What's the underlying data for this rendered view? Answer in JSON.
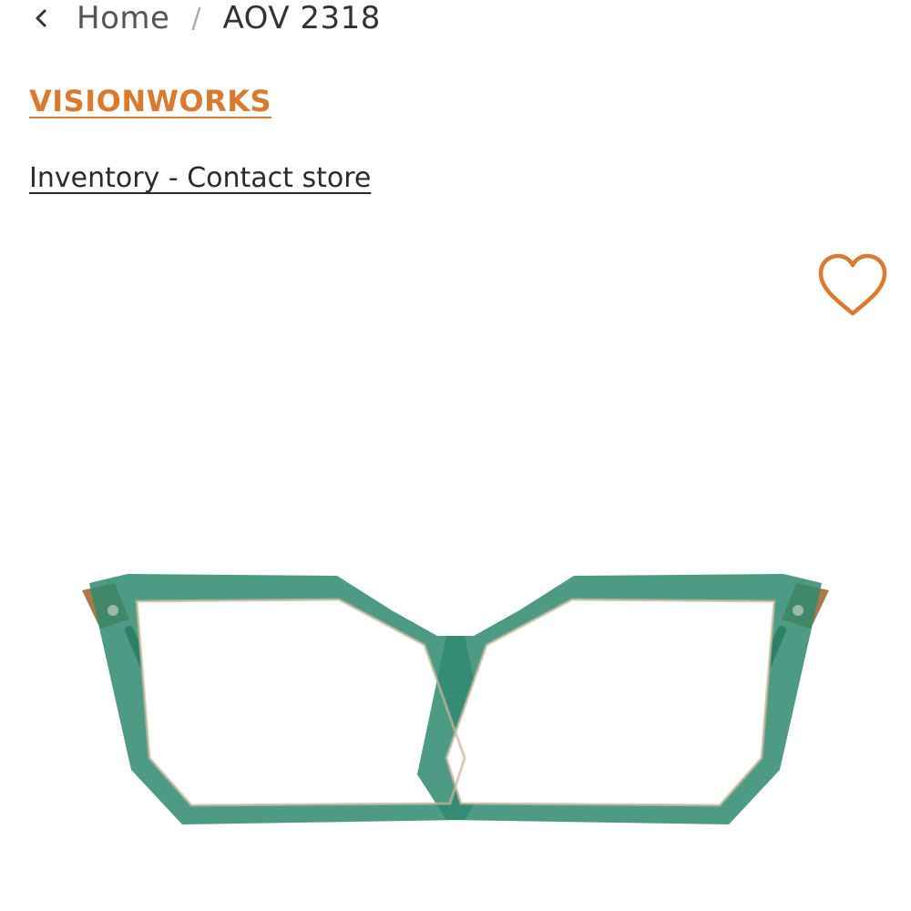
{
  "breadcrumb": {
    "home": "Home",
    "separator": "/",
    "current": "AOV 2318"
  },
  "brand": {
    "name": "VISIONWORKS",
    "color": "#d97a2e"
  },
  "inventory": {
    "label": "Inventory - Contact store"
  },
  "favorite": {
    "icon": "heart-outline-icon",
    "color": "#d97a2e"
  },
  "product": {
    "image": "green-cat-eye-eyeglasses",
    "frame_color": "#2f8a70"
  }
}
